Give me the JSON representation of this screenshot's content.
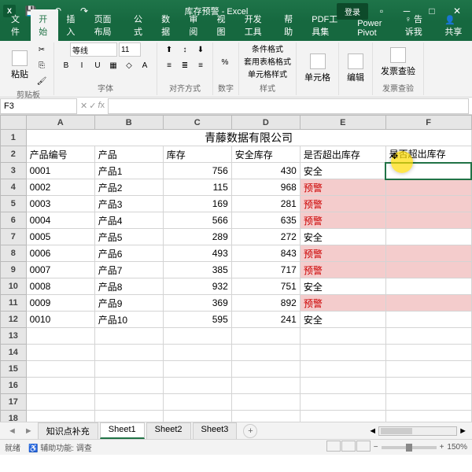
{
  "title": "库存预警 - Excel",
  "login": "登录",
  "win": {
    "min": "─",
    "max": "□",
    "close": "✕",
    "ribmin": "▫"
  },
  "tabs": [
    "文件",
    "开始",
    "插入",
    "页面布局",
    "公式",
    "数据",
    "审阅",
    "视图",
    "开发工具",
    "帮助",
    "PDF工具集",
    "Power Pivot"
  ],
  "tellme": "告诉我",
  "share": "共享",
  "activeTab": 1,
  "ribbon": {
    "clipboard": {
      "label": "剪贴板",
      "paste": "粘贴"
    },
    "font": {
      "label": "字体",
      "name": "等线",
      "size": "11",
      "controls": [
        "B",
        "I",
        "U",
        "▦",
        "◇",
        "A"
      ]
    },
    "align": {
      "label": "对齐方式"
    },
    "number": {
      "label": "数字",
      "sym": "%"
    },
    "styles": {
      "label": "样式",
      "cond": "条件格式",
      "tbl": "套用表格格式",
      "cell": "单元格样式"
    },
    "cells": {
      "label": "单元格"
    },
    "editing": {
      "label": "编辑"
    },
    "invoice": {
      "label": "发票查验",
      "btn": "发票查验"
    }
  },
  "namebox": "F3",
  "columns": [
    "A",
    "B",
    "C",
    "D",
    "E",
    "F"
  ],
  "widths": [
    80,
    80,
    80,
    80,
    100,
    100
  ],
  "mergedTitle": "青藤数据有限公司",
  "headers": [
    "产品编号",
    "产品",
    "库存",
    "安全库存",
    "是否超出库存",
    "是否超出库存"
  ],
  "rows": [
    {
      "r": 3,
      "c": [
        "0001",
        "产品1",
        "756",
        "430",
        "安全",
        ""
      ],
      "warn": false
    },
    {
      "r": 4,
      "c": [
        "0002",
        "产品2",
        "115",
        "968",
        "预警",
        ""
      ],
      "warn": true
    },
    {
      "r": 5,
      "c": [
        "0003",
        "产品3",
        "169",
        "281",
        "预警",
        ""
      ],
      "warn": true
    },
    {
      "r": 6,
      "c": [
        "0004",
        "产品4",
        "566",
        "635",
        "预警",
        ""
      ],
      "warn": true
    },
    {
      "r": 7,
      "c": [
        "0005",
        "产品5",
        "289",
        "272",
        "安全",
        ""
      ],
      "warn": false
    },
    {
      "r": 8,
      "c": [
        "0006",
        "产品6",
        "493",
        "843",
        "预警",
        ""
      ],
      "warn": true
    },
    {
      "r": 9,
      "c": [
        "0007",
        "产品7",
        "385",
        "717",
        "预警",
        ""
      ],
      "warn": true
    },
    {
      "r": 10,
      "c": [
        "0008",
        "产品8",
        "932",
        "751",
        "安全",
        ""
      ],
      "warn": false
    },
    {
      "r": 11,
      "c": [
        "0009",
        "产品9",
        "369",
        "892",
        "预警",
        ""
      ],
      "warn": true
    },
    {
      "r": 12,
      "c": [
        "0010",
        "产品10",
        "595",
        "241",
        "安全",
        ""
      ],
      "warn": false
    }
  ],
  "emptyRows": [
    13,
    14,
    15,
    16,
    17,
    18
  ],
  "sheets": [
    "知识点补充",
    "Sheet1",
    "Sheet2",
    "Sheet3"
  ],
  "activeSheet": 1,
  "status": {
    "ready": "就绪",
    "rec": "辅助功能: 调查",
    "zoom": "150%"
  }
}
